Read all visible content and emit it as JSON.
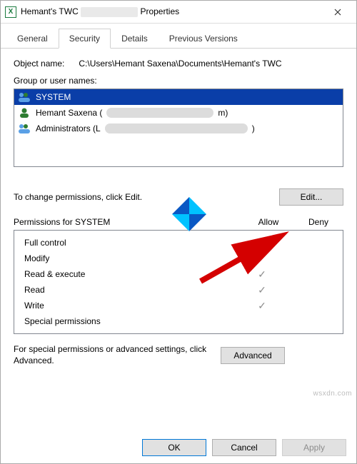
{
  "titlebar": {
    "title_prefix": "Hemant's TWC",
    "title_suffix": "Properties"
  },
  "tabs": [
    "General",
    "Security",
    "Details",
    "Previous Versions"
  ],
  "active_tab": "Security",
  "object_name_label": "Object name:",
  "object_name_value": "C:\\Users\\Hemant Saxena\\Documents\\Hemant's TWC",
  "group_label": "Group or user names:",
  "groups": [
    {
      "name": "SYSTEM",
      "selected": true,
      "icon": "group"
    },
    {
      "name": "Hemant Saxena (",
      "suffix": "m)",
      "selected": false,
      "icon": "user"
    },
    {
      "name": "Administrators (L",
      "suffix": ")",
      "selected": false,
      "icon": "group"
    }
  ],
  "change_text": "To change permissions, click Edit.",
  "edit_button": "Edit...",
  "perm_header": "Permissions for SYSTEM",
  "col_allow": "Allow",
  "col_deny": "Deny",
  "permissions": [
    {
      "name": "Full control",
      "allow": true,
      "deny": false
    },
    {
      "name": "Modify",
      "allow": true,
      "deny": false
    },
    {
      "name": "Read & execute",
      "allow": true,
      "deny": false
    },
    {
      "name": "Read",
      "allow": true,
      "deny": false
    },
    {
      "name": "Write",
      "allow": true,
      "deny": false
    },
    {
      "name": "Special permissions",
      "allow": false,
      "deny": false
    }
  ],
  "advanced_text": "For special permissions or advanced settings, click Advanced.",
  "advanced_button": "Advanced",
  "buttons": {
    "ok": "OK",
    "cancel": "Cancel",
    "apply": "Apply"
  },
  "watermark": "wsxdn.com"
}
